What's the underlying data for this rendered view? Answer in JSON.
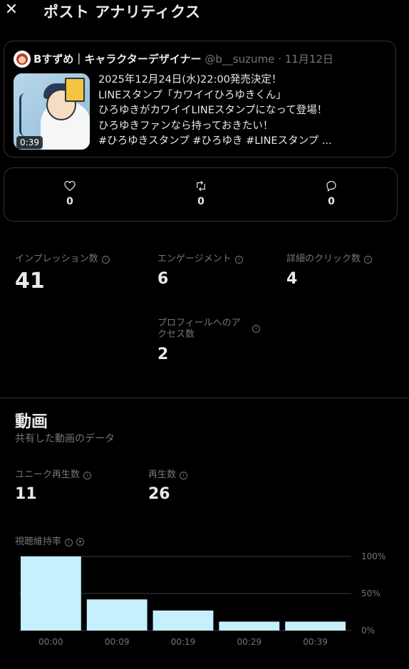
{
  "header": {
    "title": "ポスト アナリティクス",
    "close_icon": "close-icon"
  },
  "post": {
    "author_name": "Bすずめ｜キャラクターデザイナー",
    "handle": "@b__suzume",
    "separator": "·",
    "date": "11月12日",
    "video_duration": "0:39",
    "text_lines": [
      "2025年12月24日(水)22:00発売決定！",
      "LINEスタンプ「カワイイひろゆきくん」",
      "ひろゆきがカワイイLINEスタンプになって登場！",
      "ひろゆきファンなら持っておきたい！",
      "#ひろゆきスタンプ #ひろゆき  #LINEスタンプ ..."
    ]
  },
  "engagement": {
    "likes": "0",
    "reposts": "0",
    "replies": "0"
  },
  "metrics": {
    "impressions_label": "インプレッション数",
    "impressions_value": "41",
    "engagements_label": "エンゲージメント",
    "engagements_value": "6",
    "detail_clicks_label": "詳細のクリック数",
    "detail_clicks_value": "4",
    "profile_visits_label_line1": "プロフィールへのア",
    "profile_visits_label_line2": "クセス数",
    "profile_visits_value": "2"
  },
  "video": {
    "title": "動画",
    "subtitle": "共有した動画のデータ",
    "unique_views_label": "ユニーク再生数",
    "unique_views_value": "11",
    "views_label": "再生数",
    "views_value": "26",
    "retention_label": "視聴維持率"
  },
  "colors": {
    "bar": "#c6f0fe",
    "grid": "#3a3e42",
    "muted": "#71767b",
    "text": "#e7e9ea"
  },
  "chart_data": {
    "type": "bar",
    "categories": [
      "00:00",
      "00:09",
      "00:19",
      "00:29",
      "00:39"
    ],
    "values": [
      100,
      42,
      27,
      12,
      12
    ],
    "ylim": [
      0,
      100
    ],
    "y_ticks": [
      "100%",
      "50%",
      "0%"
    ],
    "y_tick_values": [
      100,
      50,
      0
    ],
    "grid": true,
    "y_axis_position": "right"
  }
}
